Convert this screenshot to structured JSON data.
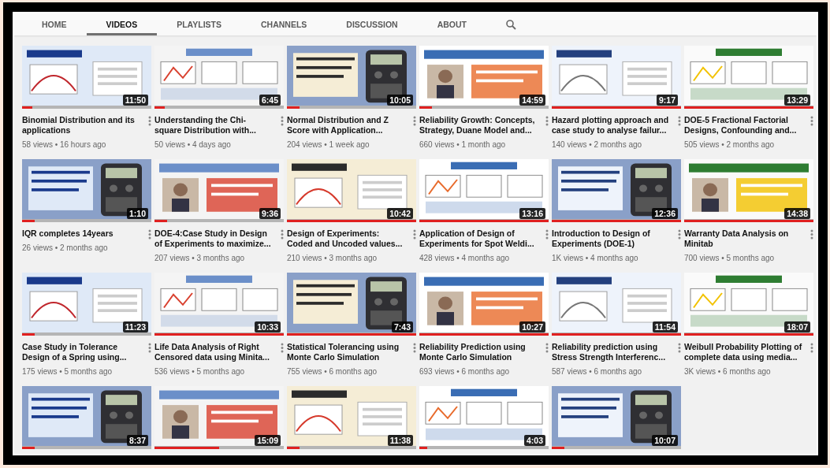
{
  "tabs": [
    {
      "label": "HOME",
      "selected": false
    },
    {
      "label": "VIDEOS",
      "selected": true
    },
    {
      "label": "PLAYLISTS",
      "selected": false
    },
    {
      "label": "CHANNELS",
      "selected": false
    },
    {
      "label": "DISCUSSION",
      "selected": false
    },
    {
      "label": "ABOUT",
      "selected": false
    }
  ],
  "videos": [
    {
      "duration": "11:50",
      "level": 0.08,
      "title": "Binomial Distribution and its applications",
      "meta": "58 views • 16 hours ago"
    },
    {
      "duration": "6:45",
      "level": 0.08,
      "title": "Understanding the Chi-square Distribution with...",
      "meta": "50 views • 4 days ago"
    },
    {
      "duration": "10:05",
      "level": 0.1,
      "title": "Normal Distribution and Z Score with Application...",
      "meta": "204 views • 1 week ago"
    },
    {
      "duration": "14:59",
      "level": 0.1,
      "title": "Reliability Growth: Concepts, Strategy, Duane Model and...",
      "meta": "660 views • 1 month ago"
    },
    {
      "duration": "9:17",
      "level": 1,
      "title": "Hazard plotting approach and case study to analyse failur...",
      "meta": "140 views • 2 months ago"
    },
    {
      "duration": "13:29",
      "level": 1,
      "title": "DOE-5 Fractional Factorial Designs, Confounding and...",
      "meta": "505 views • 2 months ago"
    },
    {
      "duration": "1:10",
      "level": 0.1,
      "title": "IQR completes 14years",
      "meta": "26 views • 2 months ago"
    },
    {
      "duration": "9:36",
      "level": 0.1,
      "title": "DOE-4:Case Study in Design of Experiments to maximize...",
      "meta": "207 views • 3 months ago"
    },
    {
      "duration": "10:42",
      "level": 1,
      "title": "Design of Experiments: Coded and Uncoded values...",
      "meta": "210 views • 3 months ago"
    },
    {
      "duration": "13:16",
      "level": 1,
      "title": "Application of Design of Experiments for Spot Weldi...",
      "meta": "428 views • 4 months ago"
    },
    {
      "duration": "12:36",
      "level": 1,
      "title": "Introduction to Design of Experiments (DOE-1)",
      "meta": "1K views • 4 months ago"
    },
    {
      "duration": "14:38",
      "level": 1,
      "title": "Warranty Data Analysis on Minitab",
      "meta": "700 views • 5 months ago"
    },
    {
      "duration": "11:23",
      "level": 0.1,
      "title": "Case Study in Tolerance Design of a Spring using...",
      "meta": "175 views • 5 months ago"
    },
    {
      "duration": "10:33",
      "level": 1,
      "title": "Life Data Analysis of Right Censored data using Minita...",
      "meta": "536 views • 5 months ago"
    },
    {
      "duration": "7:43",
      "level": 1,
      "title": "Statistical Tolerancing using Monte Carlo Simulation",
      "meta": "755 views • 6 months ago"
    },
    {
      "duration": "10:27",
      "level": 1,
      "title": "Reliability Prediction using Monte Carlo Simulation",
      "meta": "693 views • 6 months ago"
    },
    {
      "duration": "11:54",
      "level": 1,
      "title": "Reliability prediction using Stress Strength Interferenc...",
      "meta": "587 views • 6 months ago"
    },
    {
      "duration": "18:07",
      "level": 1,
      "title": "Weibull Probability Plotting of complete data using media...",
      "meta": "3K views • 6 months ago"
    },
    {
      "duration": "8:37",
      "level": 0.1
    },
    {
      "duration": "15:09",
      "level": 0.5
    },
    {
      "duration": "11:38",
      "level": 0.1
    },
    {
      "duration": "4:03",
      "level": 0.06
    },
    {
      "duration": "10:07",
      "level": 0.1
    }
  ]
}
